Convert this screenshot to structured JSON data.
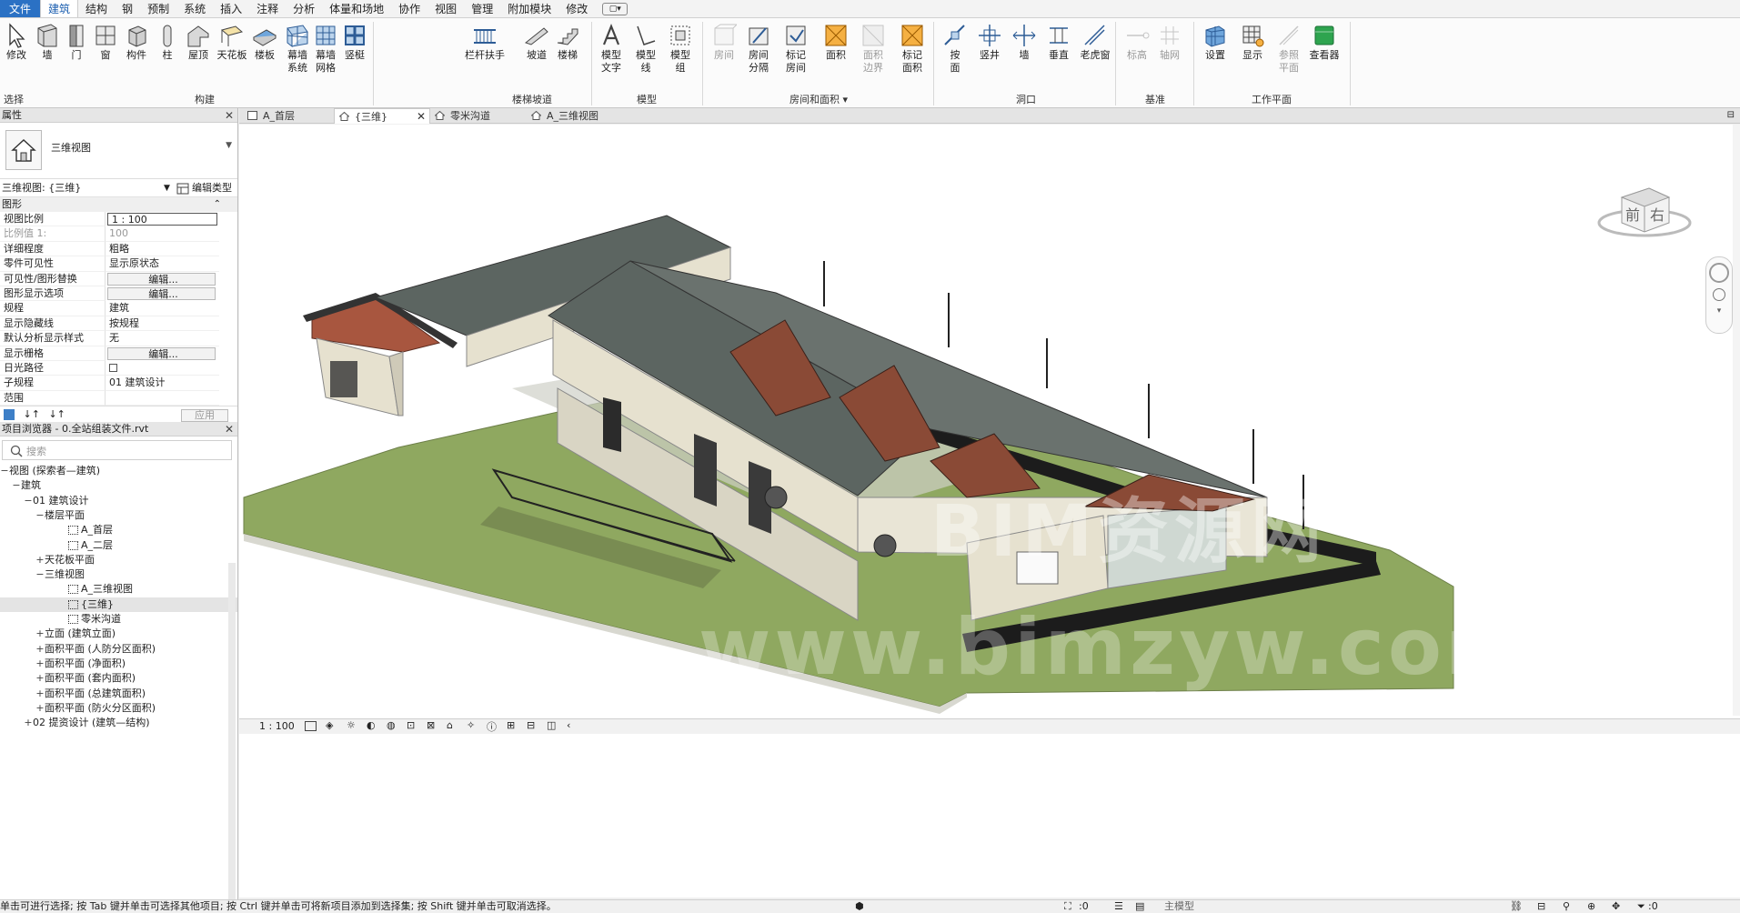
{
  "menubar": {
    "items": [
      "文件",
      "建筑",
      "结构",
      "钢",
      "预制",
      "系统",
      "插入",
      "注释",
      "分析",
      "体量和场地",
      "协作",
      "视图",
      "管理",
      "附加模块",
      "修改"
    ],
    "extra_label": "▢▾"
  },
  "ribbon": {
    "buttons": {
      "modify": "修改",
      "wall": "墙",
      "door": "门",
      "window": "窗",
      "component": "构件",
      "column": "柱",
      "roof": "屋顶",
      "ceiling": "天花板",
      "floor": "楼板",
      "curtain_system": "幕墙\n系统",
      "curtain_grid": "幕墙\n网格",
      "mullion": "竖梃",
      "railing": "栏杆扶手",
      "ramp": "坡道",
      "stair": "楼梯",
      "model_text": "模型\n文字",
      "model_line": "模型\n线",
      "model_group": "模型\n组",
      "room": "房间",
      "room_separator": "房间\n分隔",
      "tag_room": "标记\n房间",
      "area": "面积",
      "area_boundary": "面积\n边界",
      "tag_area": "标记\n面积",
      "by_face": "按\n面",
      "shaft": "竖井",
      "opening_wall": "墙",
      "vertical": "垂直",
      "dormer": "老虎窗",
      "level": "标高",
      "grid": "轴网",
      "set": "设置",
      "show": "显示",
      "ref_plane": "参照\n平面",
      "viewer": "查看器"
    },
    "panels": {
      "select": "选择 ▾",
      "build": "构建",
      "circulation": "楼梯坡道",
      "model": "模型",
      "room_area": "房间和面积 ▾",
      "opening": "洞口",
      "datum": "基准",
      "work_plane": "工作平面"
    }
  },
  "properties": {
    "title": "属性",
    "type_name": "三维视图",
    "instance_selector": "三维视图: {三维}",
    "edit_type": "编辑类型",
    "group_graphics": "图形",
    "rows": [
      {
        "k": "视图比例",
        "v": "1 : 100"
      },
      {
        "k": "比例值 1:",
        "v": "100"
      },
      {
        "k": "详细程度",
        "v": "粗略"
      },
      {
        "k": "零件可见性",
        "v": "显示原状态"
      },
      {
        "k": "可见性/图形替换",
        "v": "编辑..."
      },
      {
        "k": "图形显示选项",
        "v": "编辑..."
      },
      {
        "k": "规程",
        "v": "建筑"
      },
      {
        "k": "显示隐藏线",
        "v": "按规程"
      },
      {
        "k": "默认分析显示样式",
        "v": "无"
      },
      {
        "k": "显示栅格",
        "v": "编辑..."
      },
      {
        "k": "日光路径",
        "v": ""
      },
      {
        "k": "子规程",
        "v": "01 建筑设计"
      },
      {
        "k": "范围",
        "v": ""
      }
    ],
    "apply": "应用"
  },
  "browser": {
    "title": "项目浏览器 - 0.全站组装文件.rvt",
    "search_placeholder": "搜索",
    "items": [
      {
        "t": "视图 (探索者—建筑)",
        "tog": "−",
        "ind": 0
      },
      {
        "t": "建筑",
        "tog": "−",
        "ind": 1
      },
      {
        "t": "01 建筑设计",
        "tog": "−",
        "ind": 2
      },
      {
        "t": "楼层平面",
        "tog": "−",
        "ind": 3
      },
      {
        "t": "A_首层",
        "tog": "",
        "ind": 5,
        "icon": true
      },
      {
        "t": "A_二层",
        "tog": "",
        "ind": 5,
        "icon": true
      },
      {
        "t": "天花板平面",
        "tog": "+",
        "ind": 3
      },
      {
        "t": "三维视图",
        "tog": "−",
        "ind": 3
      },
      {
        "t": "A_三维视图",
        "tog": "",
        "ind": 5,
        "icon": true
      },
      {
        "t": "{三维}",
        "tog": "",
        "ind": 5,
        "icon": true,
        "sel": true
      },
      {
        "t": "零米沟道",
        "tog": "",
        "ind": 5,
        "icon": true
      },
      {
        "t": "立面 (建筑立面)",
        "tog": "+",
        "ind": 3
      },
      {
        "t": "面积平面 (人防分区面积)",
        "tog": "+",
        "ind": 3
      },
      {
        "t": "面积平面 (净面积)",
        "tog": "+",
        "ind": 3
      },
      {
        "t": "面积平面 (套内面积)",
        "tog": "+",
        "ind": 3
      },
      {
        "t": "面积平面 (总建筑面积)",
        "tog": "+",
        "ind": 3
      },
      {
        "t": "面积平面 (防火分区面积)",
        "tog": "+",
        "ind": 3
      },
      {
        "t": "02 提资设计 (建筑—结构)",
        "tog": "+",
        "ind": 2
      }
    ]
  },
  "tabs": [
    {
      "label": "A_首层",
      "active": false
    },
    {
      "label": "{三维}",
      "active": true
    },
    {
      "label": "零米沟道",
      "active": false
    },
    {
      "label": "A_三维视图",
      "active": false
    }
  ],
  "viewcube": {
    "front": "前",
    "right": "右"
  },
  "watermark": {
    "line1": "BIM资源网",
    "line2": "www.bimzyw.com"
  },
  "view_control": {
    "scale": "1 : 100"
  },
  "status": {
    "message": "单击可进行选择; 按 Tab 键并单击可选择其他项目; 按 Ctrl 键并单击可将新项目添加到选择集; 按 Shift 键并单击可取消选择。",
    "count": ":0",
    "model": "主模型",
    "filter_count": ":0"
  },
  "colors": {
    "file_menu": "#2b71c4",
    "grass": "#8fa860",
    "roof": "#5c6561",
    "wall": "#e6e1cf"
  }
}
